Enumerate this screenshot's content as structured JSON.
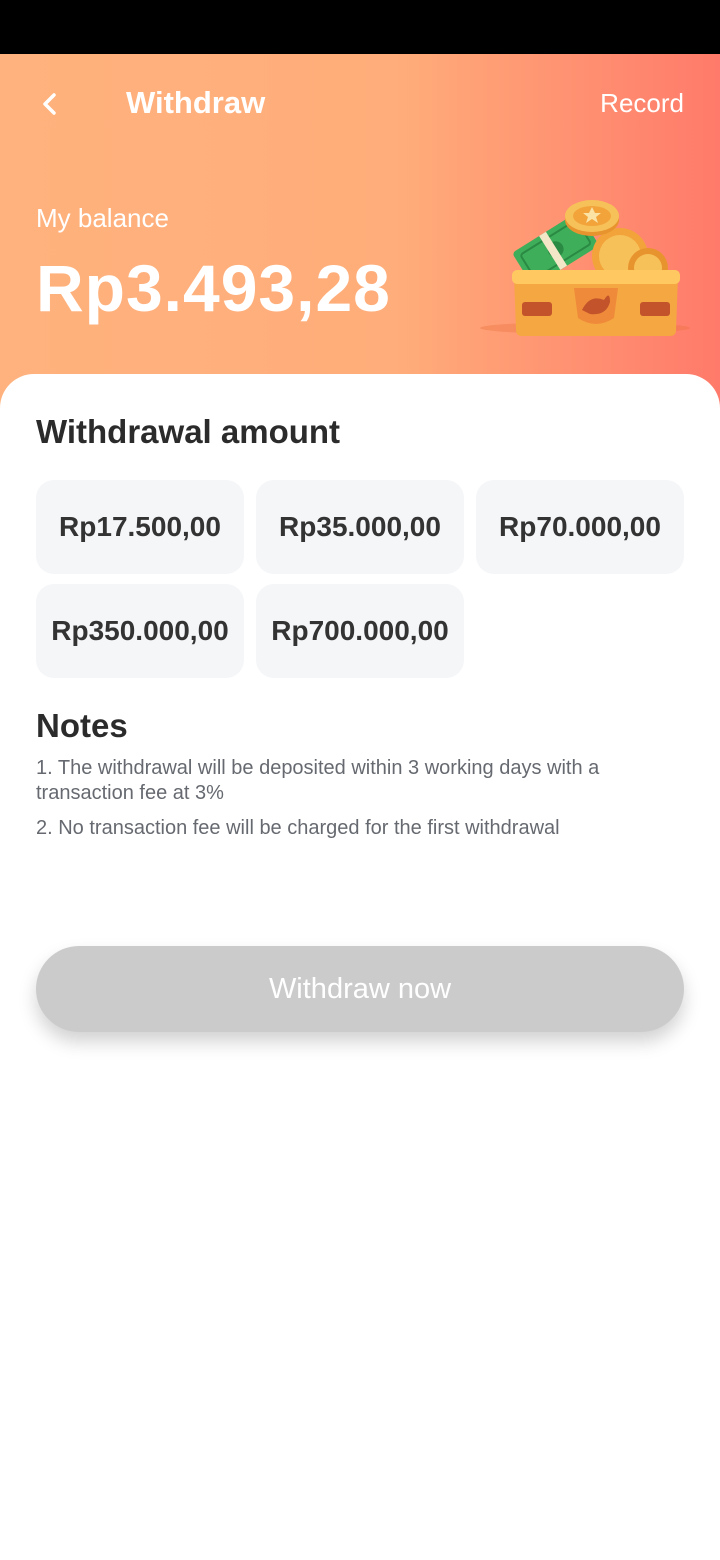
{
  "header": {
    "title": "Withdraw",
    "record_label": "Record",
    "balance_label": "My balance",
    "balance_value": "Rp3.493,28"
  },
  "icons": {
    "back": "chevron-left-icon",
    "chest": "treasure-chest-coins-illustration"
  },
  "withdrawal": {
    "title": "Withdrawal amount",
    "options": [
      {
        "label": "Rp17.500,00"
      },
      {
        "label": "Rp35.000,00"
      },
      {
        "label": "Rp70.000,00"
      },
      {
        "label": "Rp350.000,00"
      },
      {
        "label": "Rp700.000,00"
      }
    ]
  },
  "notes": {
    "title": "Notes",
    "items": [
      "1. The withdrawal will be deposited within 3 working days with a transaction fee at 3%",
      "2. No transaction fee will be charged for the first withdrawal"
    ]
  },
  "action": {
    "withdraw_label": "Withdraw now",
    "enabled": false
  },
  "colors": {
    "header_gradient_start": "#ffb27d",
    "header_gradient_end": "#ff7a6a",
    "button_disabled": "#cbcbcb",
    "option_bg": "#f5f6f8"
  }
}
